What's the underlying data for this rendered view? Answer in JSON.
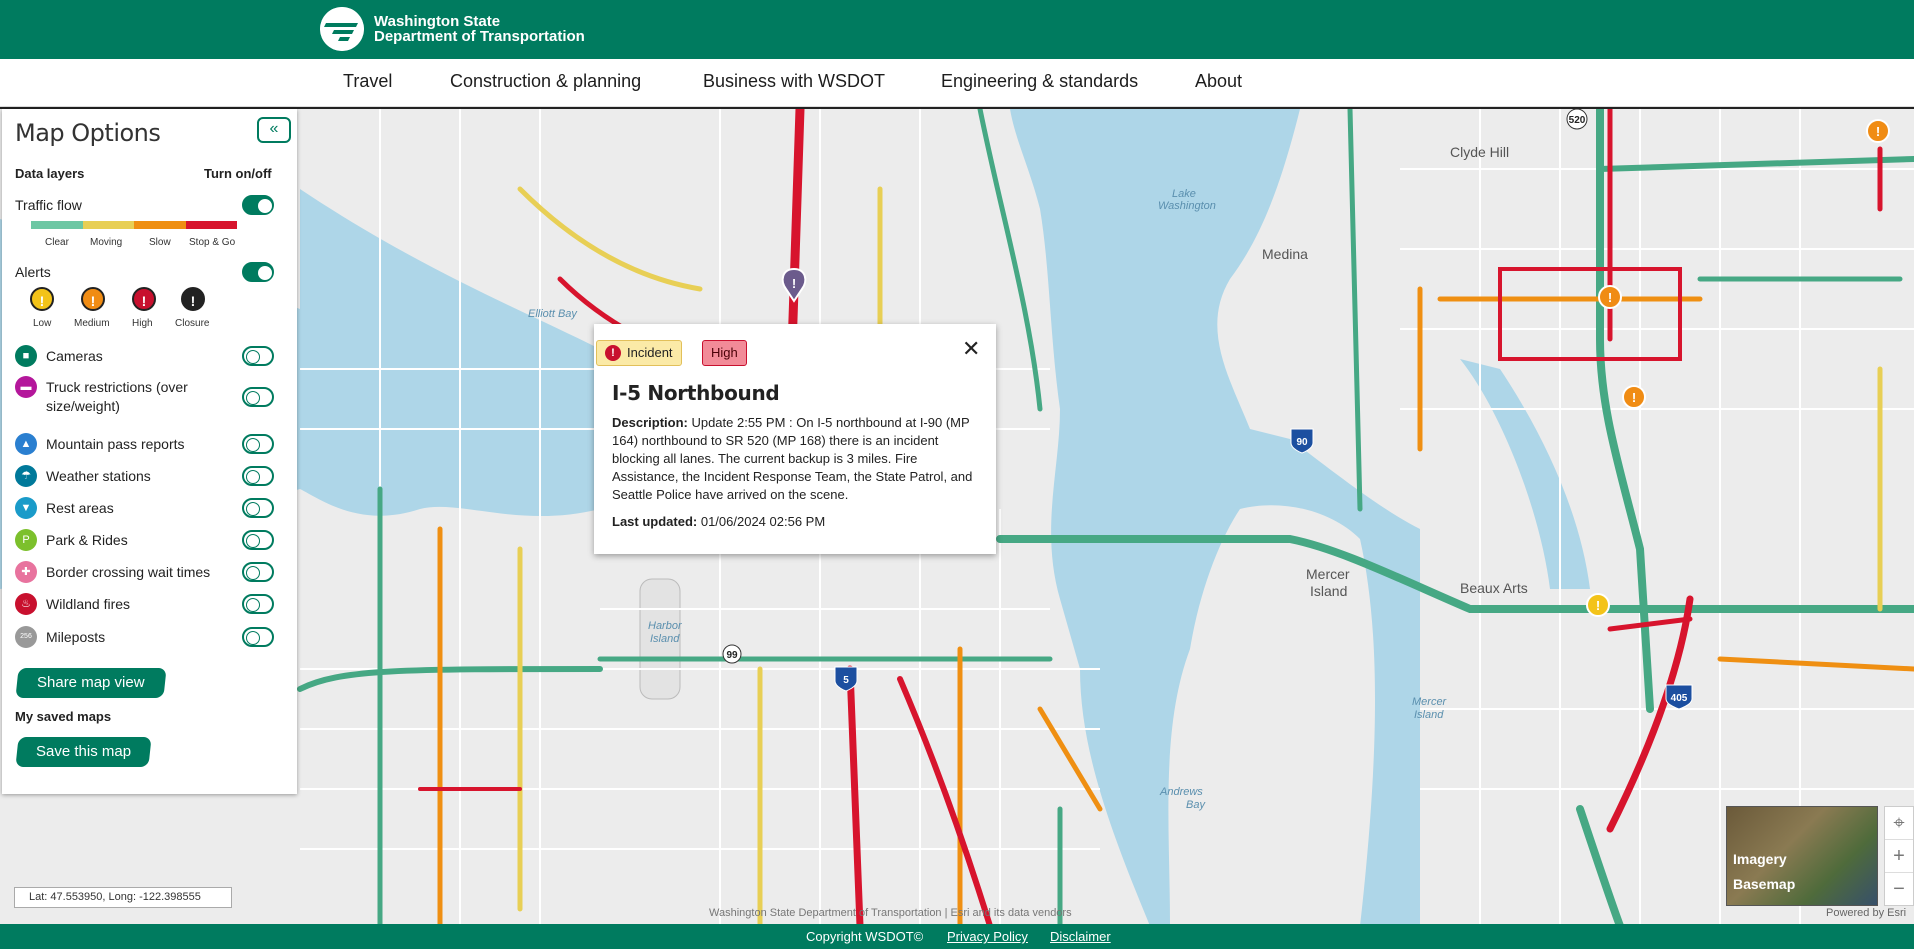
{
  "header": {
    "org_line1": "Washington State",
    "org_line2": "Department of Transportation"
  },
  "nav": {
    "items": [
      {
        "label": "Travel"
      },
      {
        "label": "Construction & planning"
      },
      {
        "label": "Business with WSDOT"
      },
      {
        "label": "Engineering & standards"
      },
      {
        "label": "About"
      }
    ]
  },
  "panel": {
    "title": "Map Options",
    "collapse_glyph": "«",
    "data_layers_label": "Data layers",
    "turn_on_off_label": "Turn on/off",
    "traffic_flow": {
      "label": "Traffic flow",
      "on": true,
      "legend": [
        {
          "label": "Clear",
          "color": "#6dc7a4"
        },
        {
          "label": "Moving",
          "color": "#e8cf55"
        },
        {
          "label": "Slow",
          "color": "#ef8f12"
        },
        {
          "label": "Stop & Go",
          "color": "#d7142d"
        }
      ]
    },
    "alerts": {
      "label": "Alerts",
      "on": true,
      "levels": [
        {
          "label": "Low",
          "color": "#f3c319"
        },
        {
          "label": "Medium",
          "color": "#f08c14"
        },
        {
          "label": "High",
          "color": "#c8102e"
        },
        {
          "label": "Closure",
          "color": "#222222"
        }
      ]
    },
    "layers": [
      {
        "label": "Cameras",
        "icon": "camera-icon",
        "color": "#007b5f",
        "on": false
      },
      {
        "label": "Truck restrictions (over",
        "label2": "size/weight)",
        "icon": "truck-icon",
        "color": "#b4179b",
        "on": false
      },
      {
        "label": "Mountain pass reports",
        "icon": "mountain-icon",
        "color": "#2a7fd0",
        "on": false
      },
      {
        "label": "Weather stations",
        "icon": "weather-icon",
        "color": "#00799a",
        "on": false
      },
      {
        "label": "Rest areas",
        "icon": "rest-area-icon",
        "color": "#1a9bc9",
        "on": false
      },
      {
        "label": "Park & Rides",
        "icon": "park-ride-icon",
        "color": "#7cc02c",
        "on": false
      },
      {
        "label": "Border crossing wait times",
        "icon": "border-crossing-icon",
        "color": "#e8739e",
        "on": false
      },
      {
        "label": "Wildland fires",
        "icon": "fire-icon",
        "color": "#c8102e",
        "on": false
      },
      {
        "label": "Mileposts",
        "icon": "milepost-icon",
        "color": "#999999",
        "on": false
      }
    ],
    "share_button": "Share map view",
    "saved_maps_label": "My saved maps",
    "save_button": "Save this map"
  },
  "popup": {
    "tag_incident": "Incident",
    "tag_high": "High",
    "title": "I-5 Northbound",
    "desc_label": "Description:",
    "desc_text": " Update 2:55 PM : On I-5 northbound at I-90 (MP 164) northbound to SR 520 (MP 168) there is an incident blocking all lanes. The current backup is 3 miles. Fire Assistance, the Incident Response Team, the State Patrol, and Seattle Police have arrived on the scene.",
    "updated_label": "Last updated:",
    "updated_value": " 01/06/2024 02:56 PM"
  },
  "map": {
    "coords": "Lat: 47.553950, Long: -122.398555",
    "attribution": "Washington State Department of Transportation | Esri and its data vendors",
    "powered_by": "Powered by Esri",
    "basemap_line1": "Imagery",
    "basemap_line2": "Basemap",
    "place_labels": [
      "Clyde Hill",
      "Medina",
      "Mercer Island",
      "Beaux Arts",
      "Lake Washington",
      "Elliott Bay",
      "Harbor Island",
      "Andrews Bay",
      "Mercer Island"
    ],
    "shields": [
      "520",
      "90",
      "5",
      "405",
      "99"
    ]
  },
  "footer": {
    "copyright": "Copyright WSDOT©",
    "privacy": "Privacy Policy",
    "disclaimer": "Disclaimer"
  }
}
